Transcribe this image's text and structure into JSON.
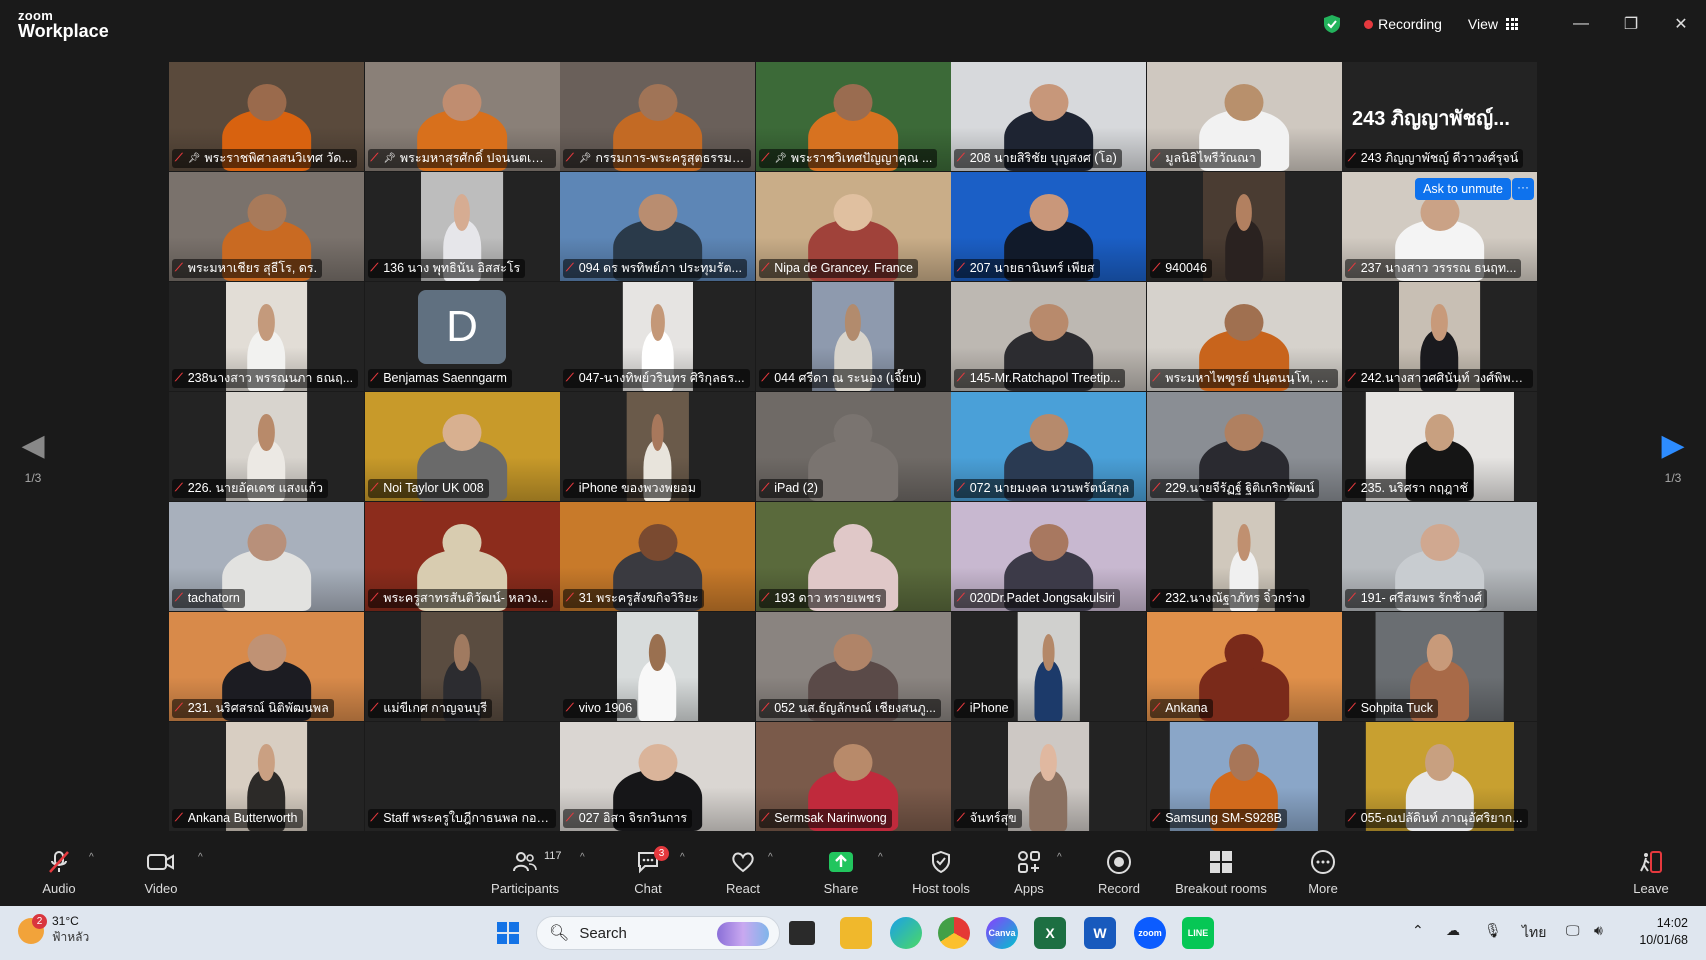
{
  "app": {
    "logo_line1": "zoom",
    "logo_line2": "Workplace",
    "recording_label": "Recording",
    "view_label": "View",
    "accent": "#0e72ed",
    "speaking_border": "#2ccc5b"
  },
  "gallery": {
    "page_left": "1/3",
    "page_right": "1/3",
    "ask_unmute": "Ask to unmute",
    "more": "···",
    "tiles": [
      {
        "name": "พระราชพิศาลสนวิเทศ วัด...",
        "pin": true,
        "bg": "#5a4a3c",
        "vid": 100,
        "shirt": "#d8620f",
        "skin": "#9a6a4c"
      },
      {
        "name": "พระมหาสุรศักดิ์ ปจนนตเสโน, ...",
        "pin": true,
        "bg": "#8a8078",
        "vid": 100,
        "shirt": "#d8701c",
        "skin": "#c08d70",
        "speaking": true
      },
      {
        "name": "กรรมการ-พระครูสุตธรรมป...",
        "pin": true,
        "bg": "#6a605a",
        "vid": 100,
        "shirt": "#c36a24",
        "skin": "#a07457"
      },
      {
        "name": "พระราชวิเทศปัญญาคุณ ...",
        "pin": true,
        "bg": "#3c6a38",
        "vid": 100,
        "shirt": "#d77220",
        "skin": "#9a6c50"
      },
      {
        "name": "208 นายสิริชัย บุญสงศ (โอ)",
        "pin": false,
        "bg": "#d7d9dc",
        "vid": 100,
        "shirt": "#1e2432",
        "skin": "#c7977a"
      },
      {
        "name": "มูลนิธิไพรีวัณณา",
        "pin": false,
        "bg": "#cfc8c0",
        "vid": 100,
        "shirt": "#f2f2f2",
        "skin": "#b8906c"
      },
      {
        "name": "243 ภิญญาพัชญ์ ดีวาวงศ์รุจน์",
        "pin": false,
        "bg": "#232323",
        "vid": 0,
        "bigname": "243 ภิญญาพัชญ์..."
      },
      {
        "name": "พระมหาเชียร สุธีโร, ดร.",
        "pin": false,
        "bg": "#7a726c",
        "vid": 100,
        "shirt": "#c96a22",
        "skin": "#a87a5a"
      },
      {
        "name": "136 นาง พุทธินัน อิสสะโร",
        "pin": false,
        "bg": "#bdbdbd",
        "vid": 42,
        "shirt": "#e6e6ea",
        "skin": "#d6ac92"
      },
      {
        "name": "094 ดร พรทิพย์ภา ประทุมรัต...",
        "pin": false,
        "bg": "#5d86b6",
        "vid": 100,
        "shirt": "#2a3a4a",
        "skin": "#b98d70"
      },
      {
        "name": "Nipa de Grancey. France",
        "pin": false,
        "bg": "#c9ad88",
        "vid": 100,
        "shirt": "#a0423a",
        "skin": "#e0c0a0"
      },
      {
        "name": "207 นายธานินทร์ เพียส",
        "pin": false,
        "bg": "#1b5fc6",
        "vid": 100,
        "shirt": "#111a2a",
        "skin": "#c9977a"
      },
      {
        "name": "940046",
        "pin": false,
        "bg": "#4a3c32",
        "vid": 42,
        "shirt": "#2a2220",
        "skin": "#b28060"
      },
      {
        "name": "237 นางสาว วรรรณ ธนฤท...",
        "pin": false,
        "bg": "#d2cbc2",
        "vid": 100,
        "shirt": "#f4f4f4",
        "skin": "#caa286",
        "ask": true
      },
      {
        "name": "238นางสาว พรรณนภา ธณฤ...",
        "pin": false,
        "bg": "#e2ddd6",
        "vid": 42,
        "shirt": "#f2f2f0",
        "skin": "#c49a7c"
      },
      {
        "name": "Benjamas Saenngarm",
        "pin": false,
        "bg": "#232323",
        "vid": 0,
        "avatar": "D"
      },
      {
        "name": "047-นางทิพย์วรินทร ศิริกุลธร...",
        "pin": false,
        "bg": "#e6e4e2",
        "vid": 36,
        "shirt": "#ffffff",
        "skin": "#c49878"
      },
      {
        "name": "044 ศรีดา ณ ระนอง (เจี๊ยบ)",
        "pin": false,
        "bg": "#8e9aae",
        "vid": 42,
        "shirt": "#d8d4cc",
        "skin": "#b28b6d"
      },
      {
        "name": "145-Mr.Ratchapol Treetip...",
        "pin": false,
        "bg": "#bdb8b2",
        "vid": 100,
        "shirt": "#2c2c30",
        "skin": "#b88a6c"
      },
      {
        "name": "พระมหาไพฑูรย์ ปนฺตนนฺโท, P...",
        "pin": false,
        "bg": "#d6d2cc",
        "vid": 100,
        "shirt": "#c8641c",
        "skin": "#a07050"
      },
      {
        "name": "242.นางสาวศศินันท์ วงศ์พิพย...",
        "pin": false,
        "bg": "#c8bfb4",
        "vid": 42,
        "shirt": "#1a1a1e",
        "skin": "#c89a7a"
      },
      {
        "name": "226. นายอัคเดช แสงแก้ว",
        "pin": false,
        "bg": "#d8d4ce",
        "vid": 42,
        "shirt": "#ece9e4",
        "skin": "#b88a6a"
      },
      {
        "name": "Noi Taylor UK 008",
        "pin": false,
        "bg": "#c89a2a",
        "vid": 100,
        "shirt": "#6a6a6a",
        "skin": "#d8b090"
      },
      {
        "name": "iPhone ของพวงพยอม",
        "pin": false,
        "bg": "#6a5a4a",
        "vid": 32,
        "shirt": "#e8e4dc",
        "skin": "#a8785c"
      },
      {
        "name": "iPad (2)",
        "pin": false,
        "bg": "#6f6a66",
        "vid": 100,
        "shirt": "#7a7470",
        "skin": "#7a7470"
      },
      {
        "name": "072 นายมงคล นวนพรัตน์สกุล",
        "pin": false,
        "bg": "#4aa0d8",
        "vid": 100,
        "shirt": "#2a3a52",
        "skin": "#b68a6c"
      },
      {
        "name": "229.นายจีรัฏฐ์ ฐิติเกริกพัฒน์",
        "pin": false,
        "bg": "#8a8e94",
        "vid": 100,
        "shirt": "#2a2a30",
        "skin": "#b08060"
      },
      {
        "name": "235. นริศรา กฤฎาชั",
        "pin": false,
        "bg": "#e6e4e2",
        "vid": 76,
        "shirt": "#151515",
        "skin": "#c8a080"
      },
      {
        "name": "tachatorn",
        "pin": false,
        "bg": "#a8b0bc",
        "vid": 100,
        "shirt": "#e2e2e0",
        "skin": "#b8907a"
      },
      {
        "name": "พระครูสาทรสันติวัฒน์- หลวง...",
        "pin": false,
        "bg": "#8c2c1c",
        "vid": 100,
        "shirt": "#d8ccb0",
        "skin": "#d8ccb0"
      },
      {
        "name": "31 พระครูสังฆกิจวิริยะ",
        "pin": false,
        "bg": "#c87a2a",
        "vid": 100,
        "shirt": "#3a3a40",
        "skin": "#7a4a30"
      },
      {
        "name": "193 ดาว ทรายเพชร",
        "pin": false,
        "bg": "#5a6a3c",
        "vid": 100,
        "shirt": "#e0c8c8",
        "skin": "#e0c8c8"
      },
      {
        "name": "020Dr.Padet Jongsakulsiri",
        "pin": false,
        "bg": "#c8b8d0",
        "vid": 100,
        "shirt": "#3c3a48",
        "skin": "#a87860"
      },
      {
        "name": "232.นางณัฐาภัทร จิ๋วกร่าง",
        "pin": false,
        "bg": "#d0c8bc",
        "vid": 32,
        "shirt": "#f0f0f0",
        "skin": "#c09070"
      },
      {
        "name": "191- ศรีสมพร รักช้างศ์",
        "pin": false,
        "bg": "#b8bcc0",
        "vid": 100,
        "shirt": "#c8ccd0",
        "skin": "#d0a890"
      },
      {
        "name": "231. นริศสรณ์ นิติพัฒนพล",
        "pin": false,
        "bg": "#d88a4a",
        "vid": 100,
        "shirt": "#1c1c22",
        "skin": "#c09274"
      },
      {
        "name": "แม่ขีเกศ กาญจนบุรี",
        "pin": false,
        "bg": "#5a4c40",
        "vid": 42,
        "shirt": "#2c2c30",
        "skin": "#a07a60"
      },
      {
        "name": "vivo 1906",
        "pin": false,
        "bg": "#d8dcdc",
        "vid": 42,
        "shirt": "#f8f8f8",
        "skin": "#9a7050"
      },
      {
        "name": "052 นส.ธัญลักษณ์ เชียงสนภู...",
        "pin": false,
        "bg": "#8a8480",
        "vid": 100,
        "shirt": "#5a4a48",
        "skin": "#b08468"
      },
      {
        "name": "iPhone",
        "pin": false,
        "bg": "#d0d0ce",
        "vid": 32,
        "shirt": "#1c3a6a",
        "skin": "#b48868"
      },
      {
        "name": "Ankana",
        "pin": false,
        "bg": "#e0904a",
        "vid": 100,
        "shirt": "#7a2a1a",
        "skin": "#7a2a1a"
      },
      {
        "name": "Sohpita Tuck",
        "pin": false,
        "bg": "#6a6e72",
        "vid": 66,
        "shirt": "#a86a48",
        "skin": "#c89a7a"
      },
      {
        "name": "Ankana Butterworth",
        "pin": false,
        "bg": "#d8cec2",
        "vid": 42,
        "shirt": "#2c2a28",
        "skin": "#caa082"
      },
      {
        "name": "Staff พระครูใบฎีกาธนพล กอง...",
        "pin": false,
        "bg": "#232323",
        "vid": 0
      },
      {
        "name": "027 อิสา จิรกวินการ",
        "pin": false,
        "bg": "#dad6d2",
        "vid": 100,
        "shirt": "#161618",
        "skin": "#dab49a"
      },
      {
        "name": "Sermsak Narinwong",
        "pin": false,
        "bg": "#7a5a4a",
        "vid": 100,
        "shirt": "#c02a3c",
        "skin": "#b88a6a"
      },
      {
        "name": "จันทร์สุข",
        "pin": false,
        "bg": "#cdc8c4",
        "vid": 42,
        "shirt": "#8a7060",
        "skin": "#e0b8a0"
      },
      {
        "name": "Samsung SM-S928B",
        "pin": false,
        "bg": "#8aa6c8",
        "vid": 76,
        "shirt": "#d26a1c",
        "skin": "#a87658"
      },
      {
        "name": "055-ณปลัดินท์ ภาณุอัศริยาก...",
        "pin": false,
        "bg": "#c8a030",
        "vid": 76,
        "shirt": "#e8e8ea",
        "skin": "#c8a080"
      }
    ]
  },
  "toolbar": {
    "audio": "Audio",
    "video": "Video",
    "participants": "Participants",
    "participants_count": "117",
    "chat": "Chat",
    "chat_badge": "3",
    "react": "React",
    "share": "Share",
    "host_tools": "Host tools",
    "apps": "Apps",
    "record": "Record",
    "breakout_rooms": "Breakout rooms",
    "more": "More",
    "leave": "Leave"
  },
  "taskbar": {
    "weather_temp": "31°C",
    "weather_desc": "ฟ้าหลัว",
    "weather_badge": "2",
    "search_placeholder": "Search",
    "language": "ไทย",
    "time": "14:02",
    "date": "10/01/68"
  }
}
